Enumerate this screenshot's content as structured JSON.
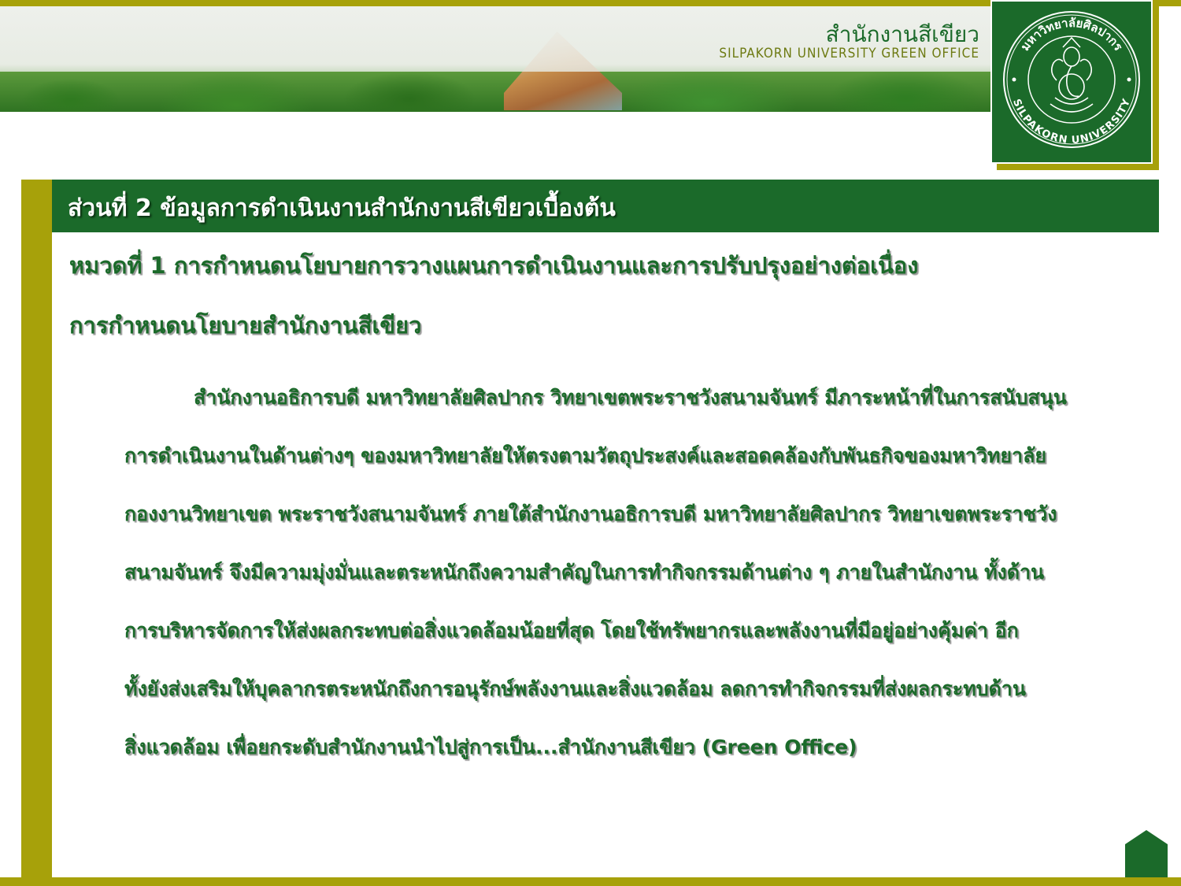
{
  "header": {
    "office_name_th": "สำนักงานสีเขียว",
    "office_name_en": "SILPAKORN UNIVERSITY GREEN OFFICE"
  },
  "logo": {
    "seal_text_top": "มหาวิทยาลัยศิลปากร",
    "seal_text_bottom": "SILPAKORN UNIVERSITY"
  },
  "section": {
    "title": "ส่วนที่ 2 ข้อมูลการดำเนินงานสำนักงานสีเขียวเบื้องต้น",
    "category": "หมวดที่ 1 การกำหนดนโยบายการวางแผนการดำเนินงานและการปรับปรุงอย่างต่อเนื่อง",
    "subheading": "การกำหนดนโยบายสำนักงานสีเขียว"
  },
  "body": {
    "lines": [
      "สำนักงานอธิการบดี มหาวิทยาลัยศิลปากร วิทยาเขตพระราชวังสนามจันทร์ มีภาระหน้าที่ในการสนับสนุน",
      "การดำเนินงานในด้านต่างๆ ของมหาวิทยาลัยให้ตรงตามวัตถุประสงค์และสอดคล้องกับพันธกิจของมหาวิทยาลัย",
      "กองงานวิทยาเขต พระราชวังสนามจันทร์  ภายใต้สำนักงานอธิการบดี มหาวิทยาลัยศิลปากร วิทยาเขตพระราชวัง",
      "สนามจันทร์ จึงมีความมุ่งมั่นและตระหนักถึงความสำคัญในการทำกิจกรรมด้านต่าง ๆ  ภายในสำนักงาน  ทั้งด้าน",
      "การบริหารจัดการให้ส่งผลกระทบต่อสิ่งแวดล้อมน้อยที่สุด   โดยใช้ทรัพยากรและพลังงานที่มีอยู่อย่างคุ้มค่า  อีก",
      "ทั้งยังส่งเสริมให้บุคลากรตระหนักถึงการอนุรักษ์พลังงานและสิ่งแวดล้อม  ลดการทำกิจกรรมที่ส่งผลกระทบด้าน",
      "สิ่งแวดล้อม เพื่อยกระดับสำนักงานนำไปสู่การเป็น...สำนักงานสีเขียว (Green Office)"
    ]
  },
  "colors": {
    "green": "#1b6a2a",
    "olive": "#a7a10a",
    "white": "#ffffff"
  },
  "icons": {
    "logo": "silpakorn-seal-icon",
    "corner": "home-icon"
  }
}
